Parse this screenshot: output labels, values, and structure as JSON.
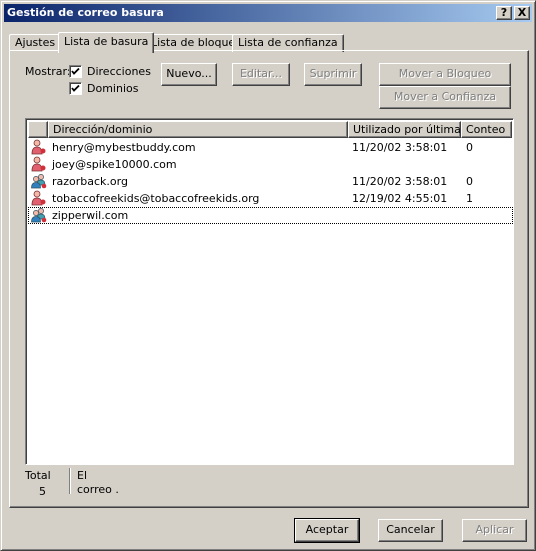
{
  "window": {
    "title": "Gestión de correo basura",
    "help_button": "?",
    "close_button": "X"
  },
  "tabs": [
    {
      "label": "Ajustes"
    },
    {
      "label": "Lista de basura"
    },
    {
      "label": "Lista de bloqueo"
    },
    {
      "label": "Lista de confianza"
    }
  ],
  "filters": {
    "show_label": "Mostrar:",
    "addresses": {
      "label": "Direcciones",
      "checked": true
    },
    "domains": {
      "label": "Dominios",
      "checked": true
    }
  },
  "actions": {
    "new": "Nuevo...",
    "edit": "Editar...",
    "delete": "Suprimir",
    "move_block": "Mover a Bloqueo",
    "move_trust": "Mover a Confianza"
  },
  "list": {
    "columns": [
      "Dirección/dominio",
      "Utilizado por última ...",
      "Conteo"
    ],
    "rows": [
      {
        "icon": "person-icon",
        "name": "henry@mybestbuddy.com",
        "last_used": "11/20/02 3:58:01",
        "count": "0"
      },
      {
        "icon": "person-icon",
        "name": "joey@spike10000.com",
        "last_used": "",
        "count": ""
      },
      {
        "icon": "group-icon",
        "name": "razorback.org",
        "last_used": "11/20/02 3:58:01",
        "count": "0"
      },
      {
        "icon": "person-icon",
        "name": "tobaccofreekids@tobaccofreekids.org",
        "last_used": "12/19/02 4:55:01",
        "count": "1"
      },
      {
        "icon": "group-icon",
        "name": "zipperwil.com",
        "last_used": "",
        "count": ""
      }
    ]
  },
  "status": {
    "total_label": "Total",
    "total_value": "5",
    "desc_line1": "El",
    "desc_line2": "correo ."
  },
  "footer": {
    "ok": "Aceptar",
    "cancel": "Cancelar",
    "apply": "Aplicar"
  },
  "colors": {
    "titlebar_start": "#0a246a",
    "titlebar_end": "#a6caf0",
    "face": "#d4d0c8"
  }
}
